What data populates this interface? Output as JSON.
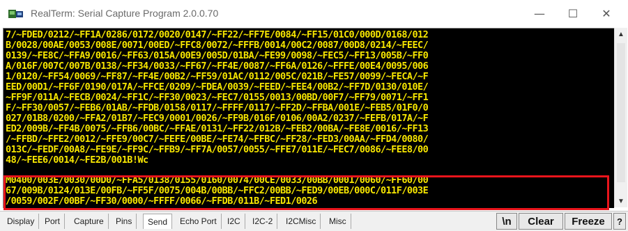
{
  "window": {
    "title": "RealTerm: Serial Capture Program 2.0.0.70",
    "minimize_glyph": "—",
    "maximize_glyph": "☐",
    "close_glyph": "✕"
  },
  "terminal": {
    "text_color": "#f7e600",
    "background": "#000000",
    "lines": [
      "7/~FDED/0212/~FF1A/0286/0172/0020/0147/~FF22/~FF7E/0084/~FF15/01C0/000D/0168/012",
      "B/0028/00AE/0053/008E/0071/00ED/~FFC8/0072/~FFFB/0014/00C2/0087/00D8/0214/~FEEC/",
      "0139/~FE8C/~FFA9/0016/~FF63/015A/00E9/005D/01BA/~FE99/0098/~FEC5/~FF13/005B/~FF0",
      "A/016F/007C/007B/0138/~FF34/0033/~FF67/~FF4E/0087/~FF6A/0126/~FFFE/00E4/0095/006",
      "1/0120/~FF54/0069/~FF87/~FF4E/00B2/~FF59/01AC/0112/005C/021B/~FE57/0099/~FECA/~F",
      "EED/00D1/~FF6F/0190/017A/~FFCE/0209/~FDEA/0039/~FEED/~FEE4/00B2/~FF7D/0130/010E/",
      "~FF9F/011A/~FECB/0024/~FF1C/~FF30/0023/~FEC7/0155/0013/00BD/00F7/~FF79/0071/~FF1",
      "F/~FF30/0057/~FEB6/01AB/~FFDB/0158/0117/~FFFF/0117/~FF2D/~FFBA/001E/~FEB5/01F0/0",
      "027/01B8/0200/~FFA2/01B7/~FEC9/0001/0026/~FF9B/016F/0106/00A2/0237/~FEFB/017A/~F",
      "ED2/009B/~FF4B/0075/~FFB6/00BC/~FFAE/0131/~FF22/012B/~FEB2/00BA/~FE8E/0016/~FF13",
      "/~FFBD/~FFE2/0012/~FFE9/00C7/~FEFE/00BE/~FE74/~FFBC/~FF28/~FED3/00AA/~FFD4/0080/",
      "013C/~FEDF/00A8/~FE9E/~FF9C/~FFB9/~FF7A/0057/0055/~FFE7/011E/~FEC7/0086/~FEE8/00",
      "48/~FEE6/0014/~FE2B/001B!Wc",
      "M0400/003E/0030/00D0/~FFA5/0138/0155/0160/0074/00CE/0033/00BB/0001/0060/~FF60/00",
      "67/009B/0124/013E/00FB/~FF5F/0075/004B/00BB/~FFC2/00BB/~FED9/00EB/000C/011F/003E",
      "/0059/002F/00BF/~FF30/0000/~FFFF/0066/~FFDB/011B/~FED1/0026"
    ]
  },
  "highlight_color": "#e8141b",
  "tabs": [
    {
      "label": "Display",
      "active": false
    },
    {
      "label": "Port",
      "active": false
    },
    {
      "label": "Capture",
      "active": false
    },
    {
      "label": "Pins",
      "active": false
    },
    {
      "label": "Send",
      "active": true
    },
    {
      "label": "Echo Port",
      "active": false
    },
    {
      "label": "I2C",
      "active": false
    },
    {
      "label": "I2C-2",
      "active": false
    },
    {
      "label": "I2CMisc",
      "active": false
    },
    {
      "label": "Misc",
      "active": false
    }
  ],
  "buttons": {
    "newline": "\\n",
    "clear": "Clear",
    "freeze": "Freeze",
    "help": "?"
  }
}
